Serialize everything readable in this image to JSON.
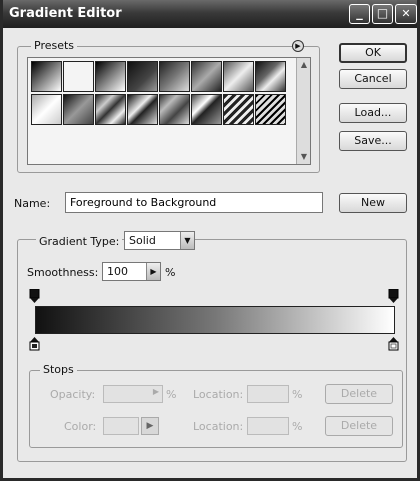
{
  "window": {
    "title": "Gradient Editor"
  },
  "titlebar": {
    "minimize": "_",
    "restore": "□",
    "close": "✕"
  },
  "presets": {
    "label": "Presets",
    "menu_icon": "circle-arrow-icon",
    "swatches": [
      {
        "name": "foreground-to-background",
        "css": "linear-gradient(135deg,#000,#fff)"
      },
      {
        "name": "foreground-to-transparent",
        "css": "linear-gradient(135deg,#111 0%,#888 60%,repeating-conic-gradient(#bbb 0 25%,#eee 0 50%) 0 0/6px 6px)"
      },
      {
        "name": "black-white",
        "css": "linear-gradient(135deg,#000,#fff)"
      },
      {
        "name": "dark-blue-gradient",
        "css": "linear-gradient(135deg,#111,#444 60%,#999)"
      },
      {
        "name": "violet-orange",
        "css": "linear-gradient(135deg,#222,#777,#ddd)"
      },
      {
        "name": "blue-red-yellow",
        "css": "linear-gradient(135deg,#333,#aaa,#222)"
      },
      {
        "name": "blue-yellow-blue",
        "css": "linear-gradient(135deg,#555,#eee,#555)"
      },
      {
        "name": "orange-yellow-orange",
        "css": "linear-gradient(135deg,#111,#666 40%,#eee 60%,#333)"
      },
      {
        "name": "violet-green-orange",
        "css": "linear-gradient(135deg,#aaa,#fff 50%,#ccc)"
      },
      {
        "name": "yellow-violet-orange",
        "css": "linear-gradient(135deg,#111,#999,#444)"
      },
      {
        "name": "copper",
        "css": "linear-gradient(135deg,#222,#ccc 30%,#333 50%,#eee 75%,#222)"
      },
      {
        "name": "chrome",
        "css": "linear-gradient(135deg,#111,#eee 40%,#222 55%,#ddd)"
      },
      {
        "name": "spectrum",
        "css": "linear-gradient(135deg,#333,#bbb 30%,#444 60%,#ddd)"
      },
      {
        "name": "transparent-rainbow",
        "css": "linear-gradient(135deg,#444,#fff 35%,#222 50%,#999)"
      },
      {
        "name": "transparent-stripes",
        "css": "repeating-linear-gradient(135deg,#222 0 3px,#eee 3px 6px)"
      },
      {
        "name": "neutral-density",
        "css": "repeating-linear-gradient(135deg,#000 0 2px,#ddd 2px 5px)"
      }
    ]
  },
  "buttons": {
    "ok": "OK",
    "cancel": "Cancel",
    "load": "Load...",
    "save": "Save...",
    "new": "New"
  },
  "name": {
    "label": "Name:",
    "value": "Foreground to Background"
  },
  "gradient_type": {
    "label": "Gradient Type:",
    "value": "Solid"
  },
  "smoothness": {
    "label": "Smoothness:",
    "value": "100",
    "unit": "%"
  },
  "stops": {
    "label": "Stops",
    "opacity_label": "Opacity:",
    "color_label": "Color:",
    "location_label": "Location:",
    "percent": "%",
    "delete_label": "Delete"
  }
}
